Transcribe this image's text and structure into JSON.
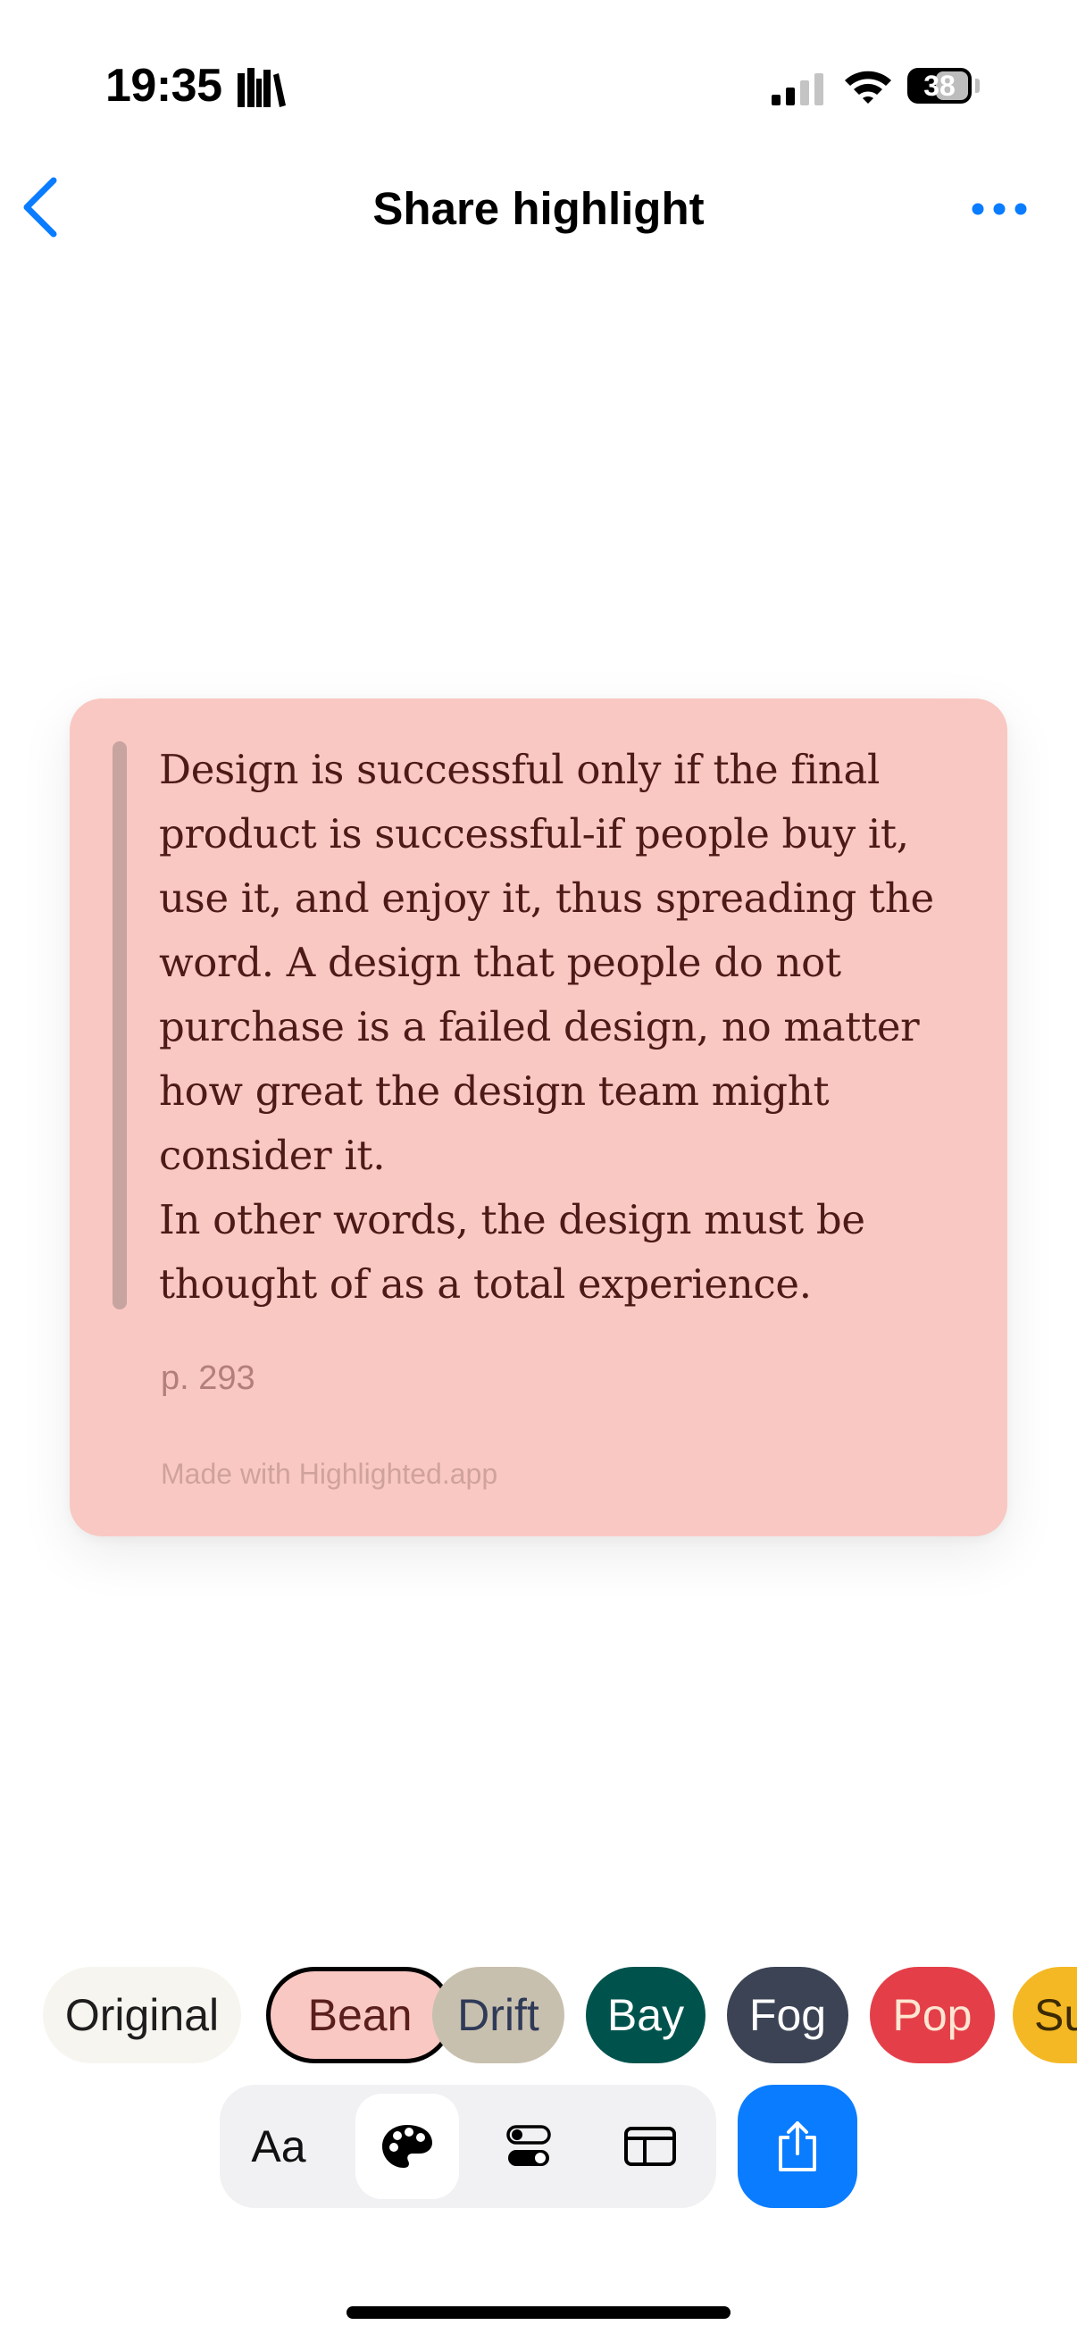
{
  "status_bar": {
    "time": "19:35",
    "battery": "38",
    "icons": [
      "books-icon",
      "signal-icon",
      "wifi-icon",
      "battery-icon"
    ]
  },
  "nav": {
    "title": "Share highlight",
    "back_icon": "chevron-left-icon",
    "more_icon": "ellipsis-icon",
    "accent_color": "#0A7CFF"
  },
  "card": {
    "quote": "Design is successful only if the final\nproduct is successful-if people buy it,\nuse it, and enjoy it, thus spreading the\nword. A design that people do not\npurchase is a failed design, no matter\nhow great the design team might\nconsider it.\nIn other words, the design must be\nthought of as a total experience.",
    "page": "p. 293",
    "made_with": "Made with Highlighted.app",
    "background_color": "#F9C8C2",
    "text_color": "#4E1A18"
  },
  "themes": {
    "selected": "Bean",
    "items": [
      {
        "label": "Original",
        "bg": "#F7F5EF",
        "fg": "#1E1E1E"
      },
      {
        "label": "Bean",
        "bg": "#F9C8C2",
        "fg": "#5A1F1B"
      },
      {
        "label": "Drift",
        "bg": "#C8C0AE",
        "fg": "#2F3A58"
      },
      {
        "label": "Bay",
        "bg": "#00534D",
        "fg": "#FFFFFF"
      },
      {
        "label": "Fog",
        "bg": "#3B4354",
        "fg": "#FFFFFF"
      },
      {
        "label": "Pop",
        "bg": "#E43F49",
        "fg": "#FFE6D2"
      },
      {
        "label": "Su",
        "bg": "#F4B824",
        "fg": "#3D2B00"
      }
    ]
  },
  "toolbar": {
    "font_label": "Aa",
    "selected_tool": "palette-icon",
    "tools": [
      "font-icon",
      "palette-icon",
      "toggles-icon",
      "layout-icon"
    ],
    "share_icon": "share-icon"
  }
}
